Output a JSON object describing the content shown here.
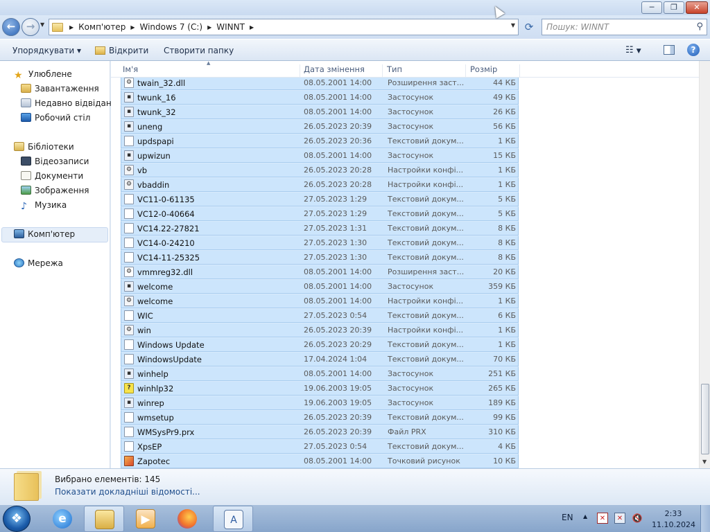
{
  "window": {
    "minimize_glyph": "─",
    "maximize_glyph": "❐",
    "close_glyph": "✕"
  },
  "address": {
    "breadcrumbs": [
      "Комп'ютер",
      "Windows 7 (C:)",
      "WINNT"
    ],
    "search_placeholder": "Пошук: WINNT"
  },
  "toolbar": {
    "organize_label": "Упорядкувати ▾",
    "open_label": "Відкрити",
    "new_folder_label": "Створити папку"
  },
  "sidebar": {
    "favorites_label": "Улюблене",
    "favorites": [
      "Завантаження",
      "Недавно відвідане",
      "Робочий стіл"
    ],
    "libraries_label": "Бібліотеки",
    "libraries": [
      "Відеозаписи",
      "Документи",
      "Зображення",
      "Музика"
    ],
    "computer_label": "Комп'ютер",
    "network_label": "Мережа"
  },
  "columns": {
    "name": "Ім'я",
    "date": "Дата змінення",
    "type": "Тип",
    "size": "Розмір"
  },
  "files": [
    {
      "name": "twain_32.dll",
      "date": "08.05.2001 14:00",
      "type": "Розширення заст...",
      "size": "44 КБ",
      "icon": "dll"
    },
    {
      "name": "twunk_16",
      "date": "08.05.2001 14:00",
      "type": "Застосунок",
      "size": "49 КБ",
      "icon": "exe"
    },
    {
      "name": "twunk_32",
      "date": "08.05.2001 14:00",
      "type": "Застосунок",
      "size": "26 КБ",
      "icon": "exe"
    },
    {
      "name": "uneng",
      "date": "26.05.2023 20:39",
      "type": "Застосунок",
      "size": "56 КБ",
      "icon": "exe"
    },
    {
      "name": "updspapi",
      "date": "26.05.2023 20:36",
      "type": "Текстовий докум...",
      "size": "1 КБ",
      "icon": "txt"
    },
    {
      "name": "upwizun",
      "date": "08.05.2001 14:00",
      "type": "Застосунок",
      "size": "15 КБ",
      "icon": "exe"
    },
    {
      "name": "vb",
      "date": "26.05.2023 20:28",
      "type": "Настройки конфі...",
      "size": "1 КБ",
      "icon": "cfg"
    },
    {
      "name": "vbaddin",
      "date": "26.05.2023 20:28",
      "type": "Настройки конфі...",
      "size": "1 КБ",
      "icon": "cfg"
    },
    {
      "name": "VC11-0-61135",
      "date": "27.05.2023 1:29",
      "type": "Текстовий докум...",
      "size": "5 КБ",
      "icon": "txt"
    },
    {
      "name": "VC12-0-40664",
      "date": "27.05.2023 1:29",
      "type": "Текстовий докум...",
      "size": "5 КБ",
      "icon": "txt"
    },
    {
      "name": "VC14.22-27821",
      "date": "27.05.2023 1:31",
      "type": "Текстовий докум...",
      "size": "8 КБ",
      "icon": "txt"
    },
    {
      "name": "VC14-0-24210",
      "date": "27.05.2023 1:30",
      "type": "Текстовий докум...",
      "size": "8 КБ",
      "icon": "txt"
    },
    {
      "name": "VC14-11-25325",
      "date": "27.05.2023 1:30",
      "type": "Текстовий докум...",
      "size": "8 КБ",
      "icon": "txt"
    },
    {
      "name": "vmmreg32.dll",
      "date": "08.05.2001 14:00",
      "type": "Розширення заст...",
      "size": "20 КБ",
      "icon": "dll"
    },
    {
      "name": "welcome",
      "date": "08.05.2001 14:00",
      "type": "Застосунок",
      "size": "359 КБ",
      "icon": "exe"
    },
    {
      "name": "welcome",
      "date": "08.05.2001 14:00",
      "type": "Настройки конфі...",
      "size": "1 КБ",
      "icon": "cfg"
    },
    {
      "name": "WIC",
      "date": "27.05.2023 0:54",
      "type": "Текстовий докум...",
      "size": "6 КБ",
      "icon": "txt"
    },
    {
      "name": "win",
      "date": "26.05.2023 20:39",
      "type": "Настройки конфі...",
      "size": "1 КБ",
      "icon": "cfg"
    },
    {
      "name": "Windows Update",
      "date": "26.05.2023 20:29",
      "type": "Текстовий докум...",
      "size": "1 КБ",
      "icon": "txt"
    },
    {
      "name": "WindowsUpdate",
      "date": "17.04.2024 1:04",
      "type": "Текстовий докум...",
      "size": "70 КБ",
      "icon": "txt"
    },
    {
      "name": "winhelp",
      "date": "08.05.2001 14:00",
      "type": "Застосунок",
      "size": "251 КБ",
      "icon": "exe"
    },
    {
      "name": "winhlp32",
      "date": "19.06.2003 19:05",
      "type": "Застосунок",
      "size": "265 КБ",
      "icon": "help"
    },
    {
      "name": "winrep",
      "date": "19.06.2003 19:05",
      "type": "Застосунок",
      "size": "189 КБ",
      "icon": "exe"
    },
    {
      "name": "wmsetup",
      "date": "26.05.2023 20:39",
      "type": "Текстовий докум...",
      "size": "99 КБ",
      "icon": "txt"
    },
    {
      "name": "WMSysPr9.prx",
      "date": "26.05.2023 20:39",
      "type": "Файл PRX",
      "size": "310 КБ",
      "icon": "txt"
    },
    {
      "name": "XpsEP",
      "date": "27.05.2023 0:54",
      "type": "Текстовий докум...",
      "size": "4 КБ",
      "icon": "txt"
    },
    {
      "name": "Zapotec",
      "date": "08.05.2001 14:00",
      "type": "Точковий рисунок",
      "size": "10 КБ",
      "icon": "img"
    }
  ],
  "details": {
    "selected_count": "Вибрано елементів: 145",
    "more_details": "Показати докладніші відомості..."
  },
  "tray": {
    "language": "EN",
    "time": "2:33",
    "date": "11.10.2024"
  }
}
